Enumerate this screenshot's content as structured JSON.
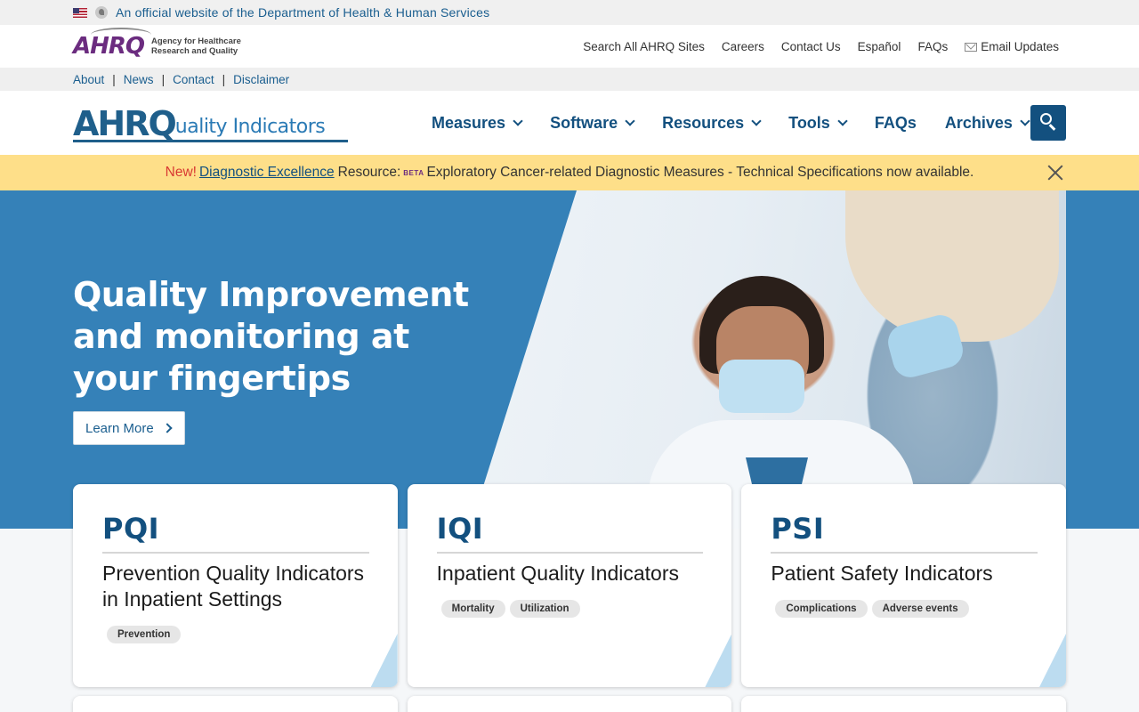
{
  "gov_banner": {
    "text": "An official website of the Department of Health & Human Services"
  },
  "agency_logo": {
    "mark": "AHRQ",
    "subtitle_line1": "Agency for Healthcare",
    "subtitle_line2": "Research and Quality"
  },
  "utility_links": [
    "Search All AHRQ Sites",
    "Careers",
    "Contact Us",
    "Español",
    "FAQs",
    "Email Updates"
  ],
  "sub_links": [
    "About",
    "News",
    "Contact",
    "Disclaimer"
  ],
  "qi_logo": {
    "mark": "AHRQ",
    "text": "uality Indicators"
  },
  "nav": {
    "items": [
      {
        "label": "Measures",
        "dropdown": true
      },
      {
        "label": "Software",
        "dropdown": true
      },
      {
        "label": "Resources",
        "dropdown": true
      },
      {
        "label": "Tools",
        "dropdown": true
      },
      {
        "label": "FAQs",
        "dropdown": false
      },
      {
        "label": "Archives",
        "dropdown": true
      }
    ]
  },
  "alert": {
    "new_label": "New!",
    "link_text": "Diagnostic Excellence",
    "resource_label": "Resource:",
    "beta_label": "BETA",
    "message": "Exploratory Cancer-related Diagnostic Measures - Technical Specifications now available."
  },
  "hero": {
    "title": "Quality Improvement and monitoring at your fingertips",
    "button_label": "Learn More"
  },
  "cards": [
    {
      "code": "PQI",
      "title": "Prevention Quality Indicators in Inpatient Settings",
      "tags": [
        "Prevention"
      ]
    },
    {
      "code": "IQI",
      "title": "Inpatient Quality Indicators",
      "tags": [
        "Mortality",
        "Utilization"
      ]
    },
    {
      "code": "PSI",
      "title": "Patient Safety Indicators",
      "tags": [
        "Complications",
        "Adverse events"
      ]
    }
  ],
  "colors": {
    "brand_blue": "#13507f",
    "hero_blue": "#3581b8",
    "alert_yellow": "#fedf89",
    "ahrq_purple": "#6b2c7f",
    "alert_red": "#d83933"
  }
}
